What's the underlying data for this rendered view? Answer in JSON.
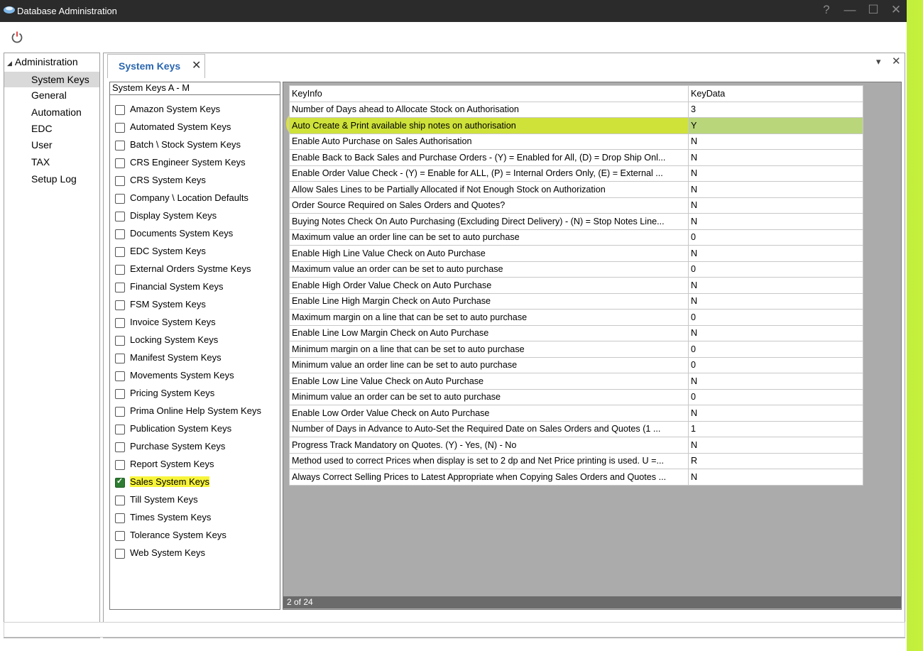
{
  "window": {
    "title": "Database Administration",
    "help": "?",
    "minimize": "—",
    "maximize": "☐",
    "close": "✕"
  },
  "nav": {
    "root": "Administration",
    "items": [
      "System Keys",
      "General",
      "Automation",
      "EDC",
      "User",
      "TAX",
      "Setup Log"
    ],
    "selected": "System Keys"
  },
  "tab": {
    "label": "System Keys",
    "close": "✕",
    "dropdown": "▾",
    "panel_close": "✕"
  },
  "list": {
    "header": "System Keys A - M",
    "items": [
      "Amazon System Keys",
      "Automated System Keys",
      "Batch \\ Stock System Keys",
      "CRS Engineer System Keys",
      "CRS System Keys",
      "Company \\ Location Defaults",
      "Display System Keys",
      "Documents System Keys",
      "EDC System Keys",
      "External Orders Systme Keys",
      "Financial System Keys",
      "FSM System Keys",
      "Invoice System Keys",
      "Locking System Keys",
      "Manifest System Keys",
      "Movements System Keys",
      "Pricing System Keys",
      "Prima Online Help System Keys",
      "Publication System Keys",
      "Purchase System Keys",
      "Report System Keys",
      "Sales System Keys",
      "Till System Keys",
      "Times System Keys",
      "Tolerance System Keys",
      "Web System Keys"
    ],
    "checked": "Sales System Keys"
  },
  "grid": {
    "columns": [
      "KeyInfo",
      "KeyData"
    ],
    "rows": [
      [
        "Number of Days ahead to Allocate Stock on Authorisation",
        "3"
      ],
      [
        "Auto Create & Print available ship notes on authorisation",
        "Y"
      ],
      [
        "Enable Auto Purchase on Sales Authorisation",
        "N"
      ],
      [
        "Enable Back to Back Sales and Purchase Orders - (Y) = Enabled for All, (D) = Drop Ship Onl...",
        "N"
      ],
      [
        "Enable Order Value Check - (Y) = Enable for ALL, (P) = Internal Orders Only, (E) = External ...",
        "N"
      ],
      [
        "Allow Sales Lines to be Partially Allocated if Not Enough Stock on Authorization",
        "N"
      ],
      [
        "Order Source Required on Sales Orders and Quotes?",
        "N"
      ],
      [
        "Buying Notes Check On Auto Purchasing (Excluding Direct Delivery) - (N) = Stop Notes Line...",
        "N"
      ],
      [
        "Maximum value an order line can be set to auto purchase",
        "0"
      ],
      [
        "Enable High Line Value Check on Auto Purchase",
        "N"
      ],
      [
        "Maximum value an order can be set to auto purchase",
        "0"
      ],
      [
        "Enable High Order Value Check on Auto Purchase",
        "N"
      ],
      [
        "Enable Line High Margin Check on Auto Purchase",
        "N"
      ],
      [
        "Maximum margin on a line that can be set to auto purchase",
        "0"
      ],
      [
        "Enable Line Low Margin Check on Auto Purchase",
        "N"
      ],
      [
        "Minimum margin on a line that can be set to auto purchase",
        "0"
      ],
      [
        "Minimum value an order line can be set to auto purchase",
        "0"
      ],
      [
        "Enable Low Line Value Check on Auto Purchase",
        "N"
      ],
      [
        "Minimum value an order can be set to auto purchase",
        "0"
      ],
      [
        "Enable Low Order Value Check on Auto Purchase",
        "N"
      ],
      [
        "Number of Days in Advance to Auto-Set the Required Date on Sales Orders and Quotes (1 ...",
        "1"
      ],
      [
        "Progress Track Mandatory on Quotes. (Y) - Yes, (N) - No",
        "N"
      ],
      [
        "Method used to correct Prices when display is set to 2 dp and Net Price printing is used. U =...",
        "R"
      ],
      [
        "Always Correct Selling Prices to Latest Appropriate when Copying Sales Orders and Quotes ...",
        "N"
      ]
    ],
    "selected_row": 1
  },
  "status": {
    "record": "2 of 24"
  },
  "colors": {
    "accent": "#2a66b0",
    "highlight": "#f6f23a",
    "selection": "#cfe23a"
  }
}
